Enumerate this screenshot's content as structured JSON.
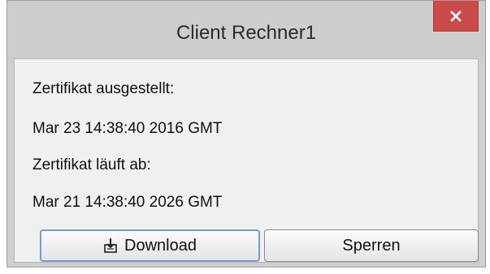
{
  "window": {
    "title": "Client Rechner1",
    "close_icon": "close-icon"
  },
  "content": {
    "issued_label": "Zertifikat ausgestellt:",
    "issued_value": "Mar 23 14:38:40 2016 GMT",
    "expires_label": "Zertifikat läuft ab:",
    "expires_value": "Mar 21 14:38:40 2026 GMT"
  },
  "buttons": {
    "download_label": "Download",
    "download_icon": "download-icon",
    "sperren_label": "Sperren"
  },
  "colors": {
    "close_button": "#c94b4b",
    "focus_border": "#6f9fd6"
  }
}
